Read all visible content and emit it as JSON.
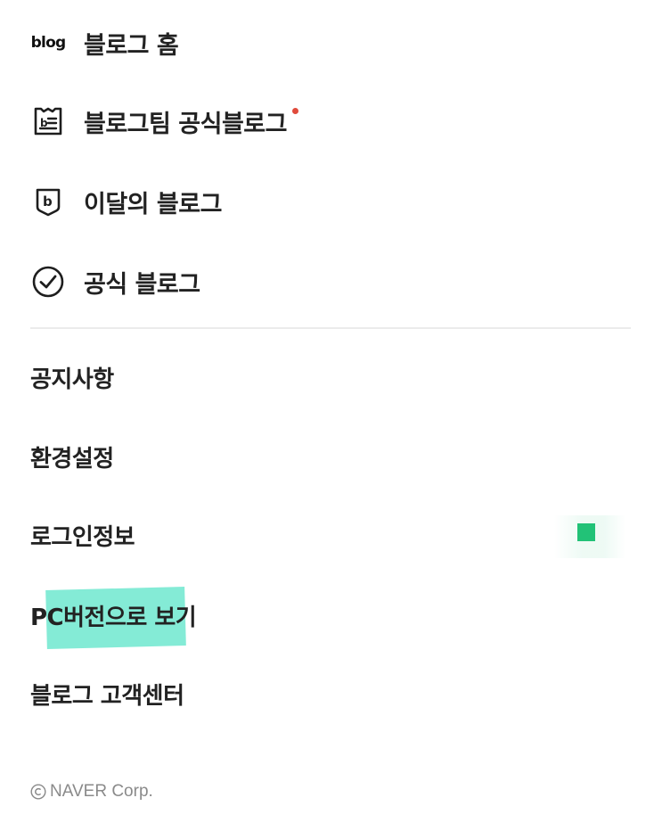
{
  "menu": {
    "primary": [
      {
        "label": "블로그 홈",
        "icon": "blog-wordmark-icon",
        "wordmark": "blog"
      },
      {
        "label": "블로그팀 공식블로그",
        "icon": "notice-board-icon",
        "new_badge": true
      },
      {
        "label": "이달의 블로그",
        "icon": "b-badge-icon"
      },
      {
        "label": "공식 블로그",
        "icon": "check-circle-icon"
      }
    ],
    "secondary": [
      {
        "label": "공지사항"
      },
      {
        "label": "환경설정"
      },
      {
        "label": "로그인정보"
      },
      {
        "label": "PC버전으로 보기"
      },
      {
        "label": "블로그 고객센터"
      }
    ]
  },
  "footer": {
    "copyright": "NAVER Corp."
  },
  "colors": {
    "badge_red": "#e04a3b",
    "highlight_mint": "#6ee7cf",
    "status_green": "#22c277",
    "divider": "#ebebeb"
  }
}
